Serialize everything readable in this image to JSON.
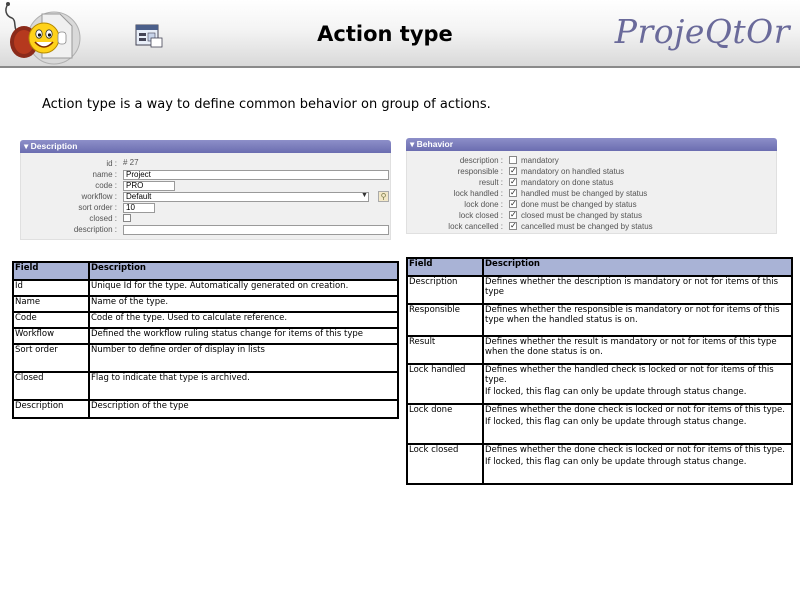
{
  "header": {
    "title": "Action type",
    "brand": "ProjeQtOr"
  },
  "intro": "Action type is a way to define common behavior on group of actions.",
  "description_panel": {
    "title": "Description",
    "fields": {
      "id_label": "id :",
      "id_value": "# 27",
      "name_label": "name :",
      "name_value": "Project",
      "code_label": "code :",
      "code_value": "PRO",
      "workflow_label": "workflow :",
      "workflow_value": "Default",
      "sort_label": "sort order :",
      "sort_value": "10",
      "closed_label": "closed :",
      "description_label": "description :"
    }
  },
  "behavior_panel": {
    "title": "Behavior",
    "rows": [
      {
        "label": "description :",
        "checked": false,
        "text": "mandatory"
      },
      {
        "label": "responsible :",
        "checked": true,
        "text": "mandatory on handled status"
      },
      {
        "label": "result :",
        "checked": true,
        "text": "mandatory on done status"
      },
      {
        "label": "lock handled :",
        "checked": true,
        "text": "handled must be changed by status"
      },
      {
        "label": "lock done :",
        "checked": true,
        "text": "done must be changed by status"
      },
      {
        "label": "lock closed :",
        "checked": true,
        "text": "closed must be changed by status"
      },
      {
        "label": "lock cancelled :",
        "checked": true,
        "text": "cancelled must be changed by status"
      }
    ]
  },
  "left_table": {
    "headers": [
      "Field",
      "Description"
    ],
    "rows": [
      [
        "Id",
        "Unique Id for the type. Automatically generated on creation."
      ],
      [
        "Name",
        "Name of the type."
      ],
      [
        "Code",
        "Code of the type. Used to calculate reference."
      ],
      [
        "Workflow",
        "Defined the workflow ruling status change for items of this type"
      ],
      [
        "Sort order",
        "Number to define order of display in lists"
      ],
      [
        "Closed",
        "Flag to indicate that type is archived."
      ],
      [
        "Description",
        "Description of the type"
      ]
    ]
  },
  "right_table": {
    "headers": [
      "Field",
      "Description"
    ],
    "rows": [
      [
        "Description",
        "Defines whether the description is mandatory or not for items of this type"
      ],
      [
        "Responsible",
        "Defines whether the responsible is mandatory or not for items of this type when the handled status is on."
      ],
      [
        "Result",
        "Defines whether the result is mandatory or not for items of this type when the done status is on."
      ],
      [
        "Lock handled",
        "Defines whether the handled check is locked or not for items of this type.",
        "If locked, this flag can only be update through status change."
      ],
      [
        "Lock done",
        "Defines whether the done check is locked or not for items of this type.",
        "If locked, this flag can only be update through status change."
      ],
      [
        "Lock closed",
        "Defines whether the done check is locked or not for items of this type.",
        "If locked, this flag can only be update through status change."
      ]
    ]
  },
  "colors": {
    "panel_header": "#7072b5",
    "table_header": "#a9b3d6",
    "brand": "#6a6a9a"
  }
}
